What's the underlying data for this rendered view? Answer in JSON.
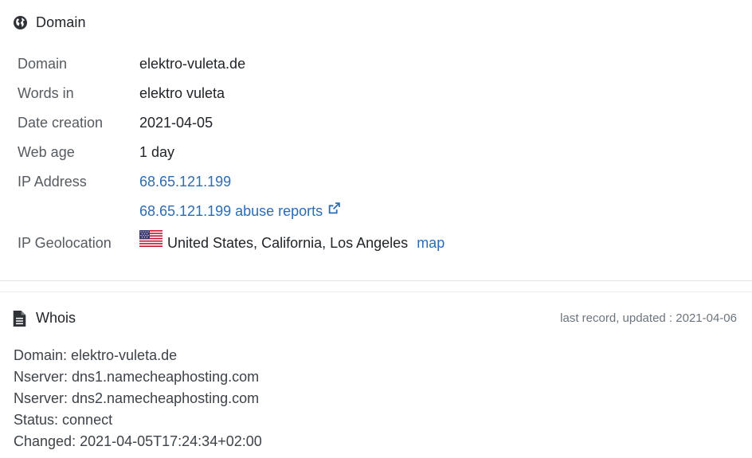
{
  "domain_panel": {
    "title": "Domain",
    "rows": {
      "domain": {
        "label": "Domain",
        "value": "elektro-vuleta.de"
      },
      "words": {
        "label": "Words in",
        "value": "elektro vuleta"
      },
      "date_creation": {
        "label": "Date creation",
        "value": "2021-04-05"
      },
      "web_age": {
        "label": "Web age",
        "value": "1 day"
      },
      "ip_address": {
        "label": "IP Address",
        "value": "68.65.121.199"
      },
      "abuse": {
        "label": "",
        "value": "68.65.121.199 abuse reports"
      },
      "geo": {
        "label": "IP Geolocation",
        "value": "United States, California, Los Angeles",
        "map_link": "map"
      }
    }
  },
  "whois_panel": {
    "title": "Whois",
    "updated": "last record, updated : 2021-04-06",
    "lines": [
      "Domain: elektro-vuleta.de",
      "Nserver: dns1.namecheaphosting.com",
      "Nserver: dns2.namecheaphosting.com",
      "Status: connect",
      "Changed: 2021-04-05T17:24:34+02:00"
    ]
  },
  "icons": {
    "domain_header": "globe-icon",
    "whois_header": "document-icon",
    "external_link": "external-link-icon",
    "flag": "us-flag-icon"
  },
  "colors": {
    "link": "#2c6cb4",
    "label": "#555b60",
    "text": "#212529",
    "muted": "#6c757d"
  }
}
